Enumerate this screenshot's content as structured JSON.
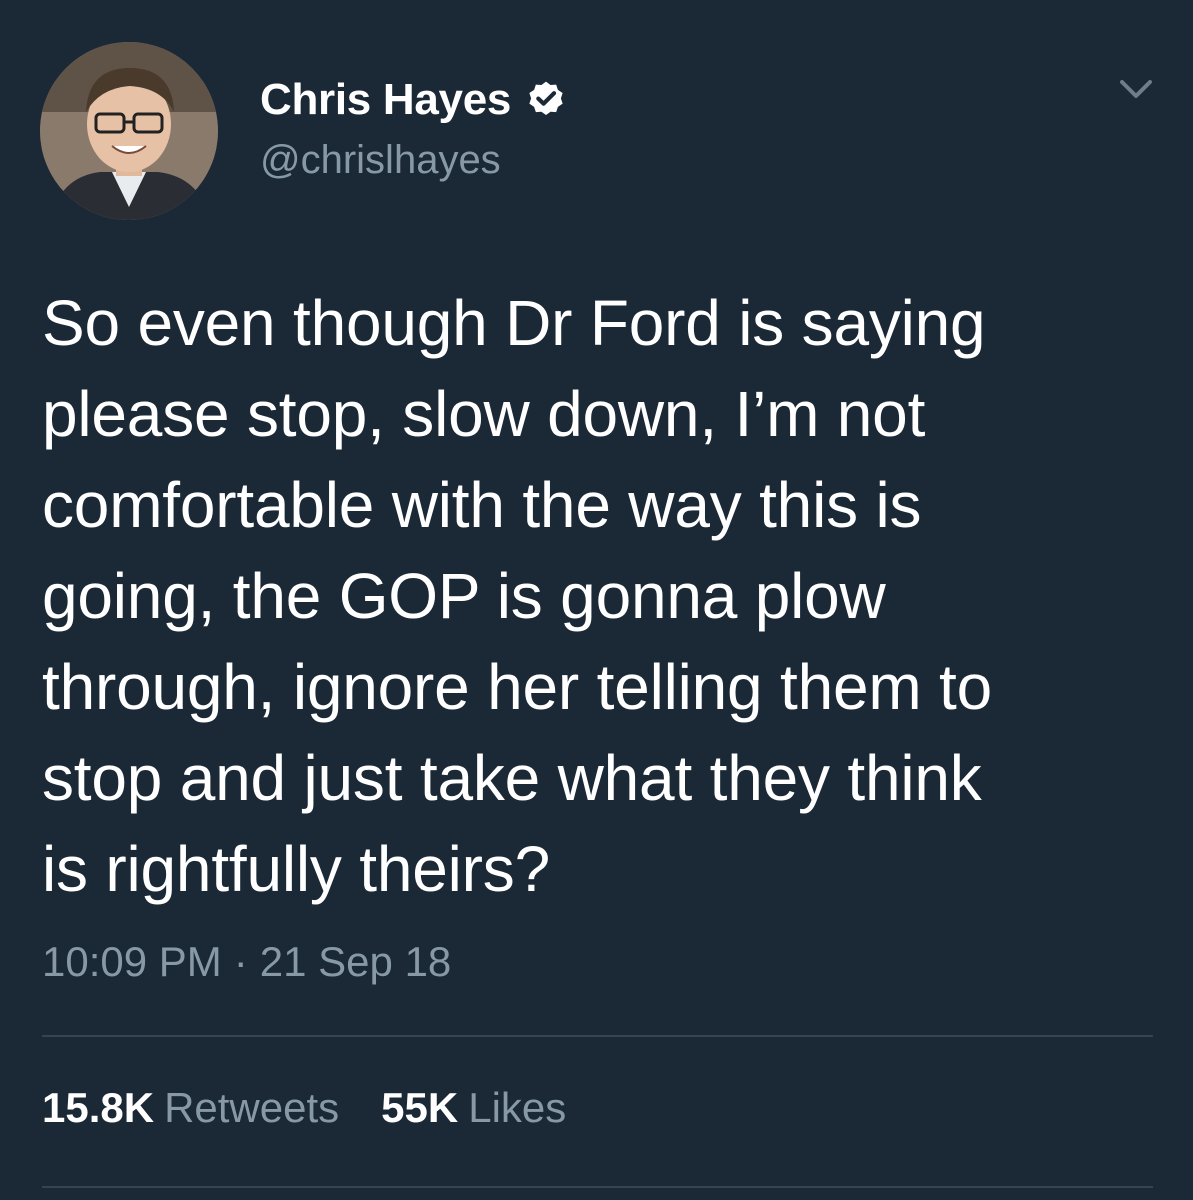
{
  "author": {
    "display_name": "Chris Hayes",
    "handle": "@chrislhayes",
    "verified_icon": "verified-badge-icon",
    "avatar_icon": "profile-photo"
  },
  "menu": {
    "icon": "chevron-down-icon"
  },
  "tweet": {
    "text": "So even though Dr Ford is saying\nplease stop, slow down, I’m not\ncomfortable with the way this is\ngoing, the GOP is gonna plow\nthrough, ignore her telling them to\nstop and just take what they think\nis rightfully theirs?",
    "time": "10:09 PM",
    "separator": "·",
    "date": "21 Sep 18"
  },
  "stats": {
    "retweets_count": "15.8K",
    "retweets_label": "Retweets",
    "likes_count": "55K",
    "likes_label": "Likes"
  },
  "colors": {
    "background": "#1b2836",
    "text": "#ffffff",
    "secondary": "#8899a6",
    "divider": "#38444d"
  }
}
